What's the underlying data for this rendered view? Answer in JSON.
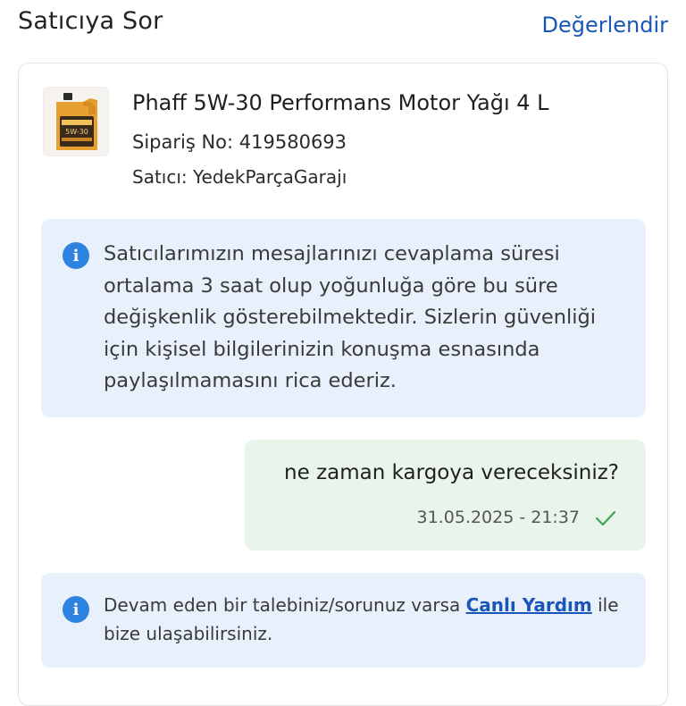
{
  "header": {
    "title": "Satıcıya Sor",
    "rate_label": "Değerlendir"
  },
  "product": {
    "name": "Phaff 5W-30 Performans Motor Yağı 4 L",
    "order_label": "Sipariş No:",
    "order_no": "419580693",
    "seller_label": "Satıcı:",
    "seller_name": "YedekParçaGarajı",
    "thumb_label": "5W-30"
  },
  "info_notice": {
    "icon": "info-icon",
    "text": "Satıcılarımızın mesajlarınızı cevaplama süresi ortalama 3 saat olup yoğunluğa göre bu süre değişkenlik gösterebilmektedir. Sizlerin güvenliği için kişisel bilgilerinizin konuşma esnasında paylaşılmamasını rica ederiz."
  },
  "message": {
    "text": "ne zaman kargoya vereceksiniz?",
    "timestamp": "31.05.2025 - 21:37",
    "status_icon": "check-icon"
  },
  "help_notice": {
    "icon": "info-icon",
    "prefix": "Devam eden bir talebiniz/sorunuz varsa",
    "link_label": "Canlı Yardım",
    "suffix": "ile bize ulaşabilirsiniz."
  },
  "colors": {
    "link": "#1a56b8",
    "info_bg": "#e8f1fb",
    "bubble_bg": "#e9f5ea",
    "check": "#3aa65a",
    "info_icon": "#2f83e0"
  }
}
